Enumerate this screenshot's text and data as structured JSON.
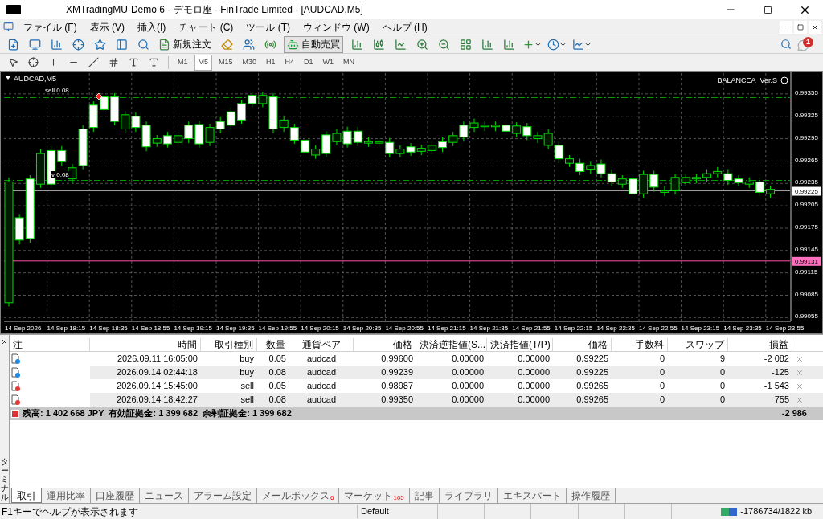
{
  "window": {
    "title": "XMTradingMU-Demo 6 - デモロ座 - FinTrade Limited - [AUDCAD,M5]"
  },
  "menu": [
    "ファイル (F)",
    "表示 (V)",
    "挿入(I)",
    "チャート (C)",
    "ツール (T)",
    "ウィンドウ (W)",
    "ヘルプ (H)"
  ],
  "notifications": {
    "count": "1"
  },
  "toolbar": {
    "new_order": {
      "label": "新規注文"
    },
    "auto_trading": {
      "label": "自動売買",
      "on": true
    }
  },
  "timeframes": [
    {
      "label": "M1",
      "selected": false
    },
    {
      "label": "M5",
      "selected": true
    },
    {
      "label": "M15",
      "selected": false
    },
    {
      "label": "M30",
      "selected": false
    },
    {
      "label": "H1",
      "selected": false
    },
    {
      "label": "H4",
      "selected": false
    },
    {
      "label": "D1",
      "selected": false
    },
    {
      "label": "W1",
      "selected": false
    },
    {
      "label": "MN",
      "selected": false
    }
  ],
  "chart": {
    "symbol": "AUDCAD,M5",
    "expert": "BALANCEA_Ver.S",
    "order_labels": [
      "sell 0.08",
      "v 0.08"
    ],
    "bid": "0.99225",
    "alert": "0.99131",
    "time_labels": [
      "14 Sep 2026",
      "14 Sep 18:15",
      "14 Sep 18:35",
      "14 Sep 18:55",
      "14 Sep 19:15",
      "14 Sep 19:35",
      "14 Sep 19:55",
      "14 Sep 20:15",
      "14 Sep 20:35",
      "14 Sep 20:55",
      "14 Sep 21:15",
      "14 Sep 21:35",
      "14 Sep 21:55",
      "14 Sep 22:15",
      "14 Sep 22:35",
      "14 Sep 22:55",
      "14 Sep 23:15",
      "14 Sep 23:35",
      "14 Sep 23:55"
    ],
    "chart_data": {
      "type": "candlestick",
      "grid": true,
      "ylim": [
        0.9905,
        0.99385
      ],
      "ref_lines": [
        {
          "axis": "y",
          "value": 0.9935,
          "color": "#00a000"
        },
        {
          "axis": "y",
          "value": 0.99239,
          "color": "#00a000"
        },
        {
          "axis": "y",
          "value": 0.99225,
          "color": "#a0a0a0"
        },
        {
          "axis": "y",
          "value": 0.99131,
          "color": "#ff4fa7"
        }
      ],
      "yticks": [
        0.99355,
        0.99325,
        0.99295,
        0.99265,
        0.99235,
        0.99205,
        0.99175,
        0.99145,
        0.99115,
        0.99085,
        0.99055
      ],
      "categories": [
        null,
        null,
        null,
        null,
        null,
        null,
        null,
        null,
        null,
        null,
        null,
        null,
        null,
        null,
        null,
        null,
        null,
        null,
        null,
        null,
        null,
        null,
        null,
        null,
        null,
        null,
        null,
        null,
        null,
        null,
        null,
        null,
        null,
        null,
        null,
        null,
        null,
        null,
        null,
        null,
        null,
        null,
        null,
        null,
        null,
        null,
        null,
        null,
        null,
        null,
        null,
        null,
        null,
        null,
        null,
        null,
        null,
        null,
        null,
        null,
        null,
        null,
        null,
        null,
        null,
        null,
        null,
        null,
        null,
        null,
        null,
        null,
        null
      ],
      "ohlc": [
        [
          0.99237,
          0.99243,
          0.9907,
          0.99075
        ],
        [
          0.99159,
          0.99194,
          0.99153,
          0.99189
        ],
        [
          0.99161,
          0.99246,
          0.99155,
          0.99241
        ],
        [
          0.99275,
          0.99281,
          0.99229,
          0.99234
        ],
        [
          0.99234,
          0.99285,
          0.99229,
          0.99279
        ],
        [
          0.99264,
          0.99285,
          0.99259,
          0.99279
        ],
        [
          0.99256,
          0.99261,
          0.99235,
          0.99241
        ],
        [
          0.99259,
          0.99313,
          0.99254,
          0.99308
        ],
        [
          0.9931,
          0.99345,
          0.99304,
          0.9934
        ],
        [
          0.99334,
          0.99356,
          0.99329,
          0.99351
        ],
        [
          0.99318,
          0.99356,
          0.99313,
          0.99351
        ],
        [
          0.99327,
          0.99332,
          0.99302,
          0.99308
        ],
        [
          0.9931,
          0.9933,
          0.99304,
          0.99325
        ],
        [
          0.99284,
          0.99318,
          0.99278,
          0.99313
        ],
        [
          0.99295,
          0.993,
          0.99284,
          0.99289
        ],
        [
          0.99288,
          0.99304,
          0.99283,
          0.99299
        ],
        [
          0.99299,
          0.99304,
          0.99285,
          0.9929
        ],
        [
          0.99295,
          0.99318,
          0.99289,
          0.99313
        ],
        [
          0.99288,
          0.99319,
          0.99283,
          0.99314
        ],
        [
          0.9931,
          0.99315,
          0.99285,
          0.9929
        ],
        [
          0.99308,
          0.99324,
          0.99302,
          0.99318
        ],
        [
          0.99313,
          0.99337,
          0.99308,
          0.99331
        ],
        [
          0.9932,
          0.99347,
          0.99315,
          0.99342
        ],
        [
          0.99342,
          0.99358,
          0.99337,
          0.99353
        ],
        [
          0.99353,
          0.99358,
          0.99337,
          0.99342
        ],
        [
          0.99308,
          0.99356,
          0.99302,
          0.99351
        ],
        [
          0.9932,
          0.99326,
          0.99304,
          0.9931
        ],
        [
          0.99293,
          0.99315,
          0.99288,
          0.9931
        ],
        [
          0.99277,
          0.99299,
          0.99272,
          0.99293
        ],
        [
          0.99281,
          0.99286,
          0.99268,
          0.99273
        ],
        [
          0.99275,
          0.99305,
          0.9927,
          0.993
        ],
        [
          0.99302,
          0.99308,
          0.99286,
          0.99291
        ],
        [
          0.99288,
          0.99311,
          0.99283,
          0.99305
        ],
        [
          0.9929,
          0.99311,
          0.99285,
          0.99305
        ],
        [
          0.99291,
          0.99297,
          0.99284,
          0.99289
        ],
        [
          0.99291,
          0.99297,
          0.99284,
          0.99289
        ],
        [
          0.99275,
          0.99296,
          0.9927,
          0.9929
        ],
        [
          0.99281,
          0.99286,
          0.9927,
          0.99275
        ],
        [
          0.99277,
          0.99289,
          0.99272,
          0.99284
        ],
        [
          0.99282,
          0.99287,
          0.99273,
          0.99278
        ],
        [
          0.99286,
          0.99291,
          0.99274,
          0.99279
        ],
        [
          0.99283,
          0.99297,
          0.99277,
          0.99291
        ],
        [
          0.99299,
          0.99304,
          0.99285,
          0.9929
        ],
        [
          0.99297,
          0.99318,
          0.99291,
          0.99313
        ],
        [
          0.99316,
          0.99322,
          0.99304,
          0.9931
        ],
        [
          0.99313,
          0.99318,
          0.99305,
          0.99311
        ],
        [
          0.99313,
          0.99318,
          0.99305,
          0.99311
        ],
        [
          0.99305,
          0.99318,
          0.993,
          0.99313
        ],
        [
          0.99312,
          0.99317,
          0.99297,
          0.99302
        ],
        [
          0.99299,
          0.99316,
          0.99293,
          0.99311
        ],
        [
          0.99299,
          0.99304,
          0.99289,
          0.99295
        ],
        [
          0.99302,
          0.99308,
          0.99281,
          0.99286
        ],
        [
          0.99268,
          0.99291,
          0.99262,
          0.99286
        ],
        [
          0.99268,
          0.99273,
          0.99257,
          0.99262
        ],
        [
          0.99251,
          0.99268,
          0.99246,
          0.99262
        ],
        [
          0.99259,
          0.99264,
          0.99248,
          0.99254
        ],
        [
          0.99248,
          0.99267,
          0.99243,
          0.99261
        ],
        [
          0.99237,
          0.99254,
          0.99232,
          0.99248
        ],
        [
          0.99241,
          0.99246,
          0.99229,
          0.99234
        ],
        [
          0.99221,
          0.99246,
          0.99216,
          0.99241
        ],
        [
          0.99247,
          0.99252,
          0.99216,
          0.99221
        ],
        [
          0.9923,
          0.99252,
          0.99224,
          0.99247
        ],
        [
          0.99225,
          0.99231,
          0.99218,
          0.99223
        ],
        [
          0.99243,
          0.99248,
          0.9922,
          0.99225
        ],
        [
          0.99243,
          0.99248,
          0.99231,
          0.99236
        ],
        [
          0.99243,
          0.99248,
          0.99235,
          0.99241
        ],
        [
          0.99248,
          0.99254,
          0.99237,
          0.99243
        ],
        [
          0.99251,
          0.99257,
          0.99243,
          0.99248
        ],
        [
          0.99239,
          0.99254,
          0.99233,
          0.99248
        ],
        [
          0.99236,
          0.99246,
          0.99231,
          0.99241
        ],
        [
          0.99237,
          0.99243,
          0.99229,
          0.99234
        ],
        [
          0.99223,
          0.99243,
          0.99218,
          0.99237
        ],
        [
          0.99227,
          0.99232,
          0.99216,
          0.99221
        ]
      ]
    }
  },
  "terminal": {
    "side_label": "ターミナル",
    "columns": [
      "注",
      "時間",
      "取引種別",
      "数量",
      "通貨ペア",
      "価格",
      "決済逆指値(S...",
      "決済指値(T/P)",
      "価格",
      "手数料",
      "スワップ",
      "損益"
    ],
    "rows": [
      {
        "kind": "buy",
        "cells": [
          "",
          "2026.09.11 16:05:00",
          "buy",
          "0.05",
          "audcad",
          "0.99600",
          "0.00000",
          "0.00000",
          "0.99225",
          "0",
          "9",
          "-2 082"
        ]
      },
      {
        "kind": "buy",
        "cells": [
          "",
          "2026.09.14 02:44:18",
          "buy",
          "0.08",
          "audcad",
          "0.99239",
          "0.00000",
          "0.00000",
          "0.99225",
          "0",
          "0",
          "-125"
        ]
      },
      {
        "kind": "sell",
        "cells": [
          "",
          "2026.09.14 15:45:00",
          "sell",
          "0.05",
          "audcad",
          "0.98987",
          "0.00000",
          "0.00000",
          "0.99265",
          "0",
          "0",
          "-1 543"
        ]
      },
      {
        "kind": "sell",
        "cells": [
          "",
          "2026.09.14 18:42:27",
          "sell",
          "0.08",
          "audcad",
          "0.99350",
          "0.00000",
          "0.00000",
          "0.99265",
          "0",
          "0",
          "755"
        ]
      }
    ],
    "summary": {
      "text": "残高: 1 402 668 JPY  有効証拠金: 1 399 682  余剰証拠金: 1 399 682",
      "total": "-2 986"
    },
    "tabs": [
      {
        "label": "取引",
        "selected": true
      },
      {
        "label": "運用比率",
        "selected": false
      },
      {
        "label": "口座履歴",
        "selected": false
      },
      {
        "label": "ニュース",
        "selected": false
      },
      {
        "label": "アラーム設定",
        "selected": false
      },
      {
        "label": "メールボックス",
        "badge": "6",
        "selected": false
      },
      {
        "label": "マーケット",
        "badge": "105",
        "selected": false
      },
      {
        "label": "記事",
        "selected": false
      },
      {
        "label": "ライブラリ",
        "selected": false
      },
      {
        "label": "エキスパート",
        "selected": false
      },
      {
        "label": "操作履歴",
        "selected": false
      }
    ]
  },
  "status_bar": {
    "help": "F1キーでヘルプが表示されます",
    "profile": "Default",
    "traffic": "-1786734/1822 kb"
  }
}
